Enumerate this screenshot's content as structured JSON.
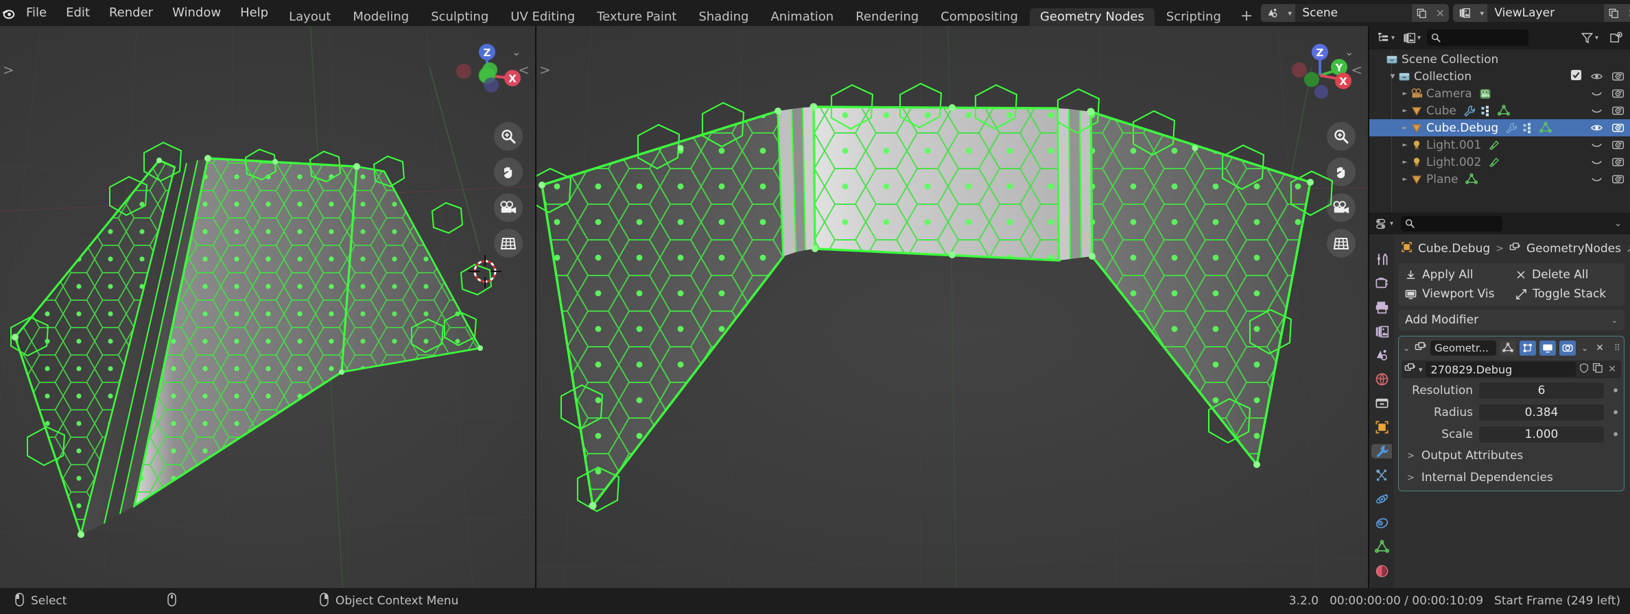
{
  "app": {
    "title": "Blender",
    "version": "3.2.0"
  },
  "topbar": {
    "logo_icon": "blender-logo-icon",
    "menus": [
      "File",
      "Edit",
      "Render",
      "Window",
      "Help"
    ],
    "workspaces": [
      {
        "label": "Layout",
        "active": false
      },
      {
        "label": "Modeling",
        "active": false
      },
      {
        "label": "Sculpting",
        "active": false
      },
      {
        "label": "UV Editing",
        "active": false
      },
      {
        "label": "Texture Paint",
        "active": false
      },
      {
        "label": "Shading",
        "active": false
      },
      {
        "label": "Animation",
        "active": false
      },
      {
        "label": "Rendering",
        "active": false
      },
      {
        "label": "Compositing",
        "active": false
      },
      {
        "label": "Geometry Nodes",
        "active": true
      },
      {
        "label": "Scripting",
        "active": false
      }
    ],
    "add_workspace_label": "+",
    "scene": {
      "icon": "scene-icon",
      "name": "Scene",
      "new_icon": "duplicate-icon",
      "unlink_icon": "close-icon"
    },
    "viewlayer": {
      "icon": "viewlayer-icon",
      "name": "ViewLayer",
      "new_icon": "duplicate-icon",
      "unlink_icon": "close-icon"
    }
  },
  "viewport_left": {
    "name": "3d-viewport-left",
    "gizmo_axes": [
      "Z",
      "X"
    ],
    "tools": [
      "zoom-icon",
      "hand-icon",
      "camera-icon",
      "grid-icon"
    ],
    "collapse_left_icon": ">",
    "collapse_right_icon": "<"
  },
  "viewport_right": {
    "name": "3d-viewport-right",
    "gizmo_axes": [
      "Z",
      "Y",
      "X"
    ],
    "tools": [
      "zoom-icon",
      "hand-icon",
      "camera-icon",
      "grid-icon"
    ],
    "collapse_left_icon": ">",
    "collapse_right_icon": "<"
  },
  "outliner": {
    "display_mode_icon": "outliner-display-mode-icon",
    "filter_type_icon": "viewlayer-icon",
    "search_placeholder": "",
    "search_value": "",
    "filter_icon": "funnel-icon",
    "new_collection_icon": "new-collection-icon",
    "rows": [
      {
        "name": "Scene Collection",
        "icon": "collection-icon",
        "indent": 0,
        "selected": false,
        "dimmed": false,
        "expandable": false,
        "expanded": false,
        "data_icons": [],
        "checkbox": false,
        "eye": "none",
        "camera": false
      },
      {
        "name": "Collection",
        "icon": "collection-icon",
        "indent": 1,
        "selected": false,
        "dimmed": false,
        "expandable": true,
        "expanded": true,
        "data_icons": [],
        "checkbox": true,
        "eye": "open",
        "camera": true
      },
      {
        "name": "Camera",
        "icon": "camera-object-icon",
        "indent": 2,
        "selected": false,
        "dimmed": true,
        "expandable": true,
        "expanded": false,
        "data_icons": [
          "camera-data-icon"
        ],
        "checkbox": false,
        "eye": "closed",
        "camera": true
      },
      {
        "name": "Cube",
        "icon": "mesh-object-icon",
        "indent": 2,
        "selected": false,
        "dimmed": true,
        "expandable": true,
        "expanded": false,
        "data_icons": [
          "wrench-icon",
          "nodes-icon",
          "mesh-data-icon"
        ],
        "checkbox": false,
        "eye": "closed",
        "camera": true
      },
      {
        "name": "Cube.Debug",
        "icon": "mesh-object-icon",
        "indent": 2,
        "selected": true,
        "dimmed": false,
        "expandable": true,
        "expanded": false,
        "data_icons": [
          "wrench-icon",
          "nodes-icon",
          "mesh-data-icon"
        ],
        "checkbox": false,
        "eye": "open",
        "camera": true
      },
      {
        "name": "Light.001",
        "icon": "light-object-icon",
        "indent": 2,
        "selected": false,
        "dimmed": true,
        "expandable": true,
        "expanded": false,
        "data_icons": [
          "light-data-icon"
        ],
        "checkbox": false,
        "eye": "closed",
        "camera": true
      },
      {
        "name": "Light.002",
        "icon": "light-object-icon",
        "indent": 2,
        "selected": false,
        "dimmed": true,
        "expandable": true,
        "expanded": false,
        "data_icons": [
          "light-data-icon"
        ],
        "checkbox": false,
        "eye": "closed",
        "camera": true
      },
      {
        "name": "Plane",
        "icon": "mesh-object-icon",
        "indent": 2,
        "selected": false,
        "dimmed": true,
        "expandable": true,
        "expanded": false,
        "data_icons": [
          "mesh-data-icon"
        ],
        "checkbox": false,
        "eye": "closed",
        "camera": true
      }
    ]
  },
  "properties": {
    "editor_type_icon": "properties-editor-icon",
    "search_placeholder": "",
    "search_value": "",
    "options_chev": "chevron-down-icon",
    "tabs": [
      {
        "name": "tool",
        "icon": "tool-icon",
        "active": false
      },
      {
        "name": "render",
        "icon": "render-icon",
        "active": false
      },
      {
        "name": "output",
        "icon": "printer-icon",
        "active": false
      },
      {
        "name": "view-layer",
        "icon": "images-icon",
        "active": false
      },
      {
        "name": "scene",
        "icon": "scene-icon",
        "active": false
      },
      {
        "name": "world",
        "icon": "world-icon",
        "active": false
      },
      {
        "name": "collection",
        "icon": "collection-icon",
        "active": false
      },
      {
        "name": "object",
        "icon": "object-icon",
        "active": false
      },
      {
        "name": "modifiers",
        "icon": "wrench-icon",
        "active": true
      },
      {
        "name": "particles",
        "icon": "particles-icon",
        "active": false
      },
      {
        "name": "physics",
        "icon": "physics-icon",
        "active": false
      },
      {
        "name": "constraints",
        "icon": "constraints-icon",
        "active": false
      },
      {
        "name": "data",
        "icon": "mesh-data-icon",
        "active": false
      },
      {
        "name": "material",
        "icon": "material-icon",
        "active": false
      },
      {
        "name": "texture",
        "icon": "texture-icon",
        "active": false
      }
    ],
    "breadcrumb": {
      "object_icon": "object-icon",
      "object": "Cube.Debug",
      "separator": ">",
      "modifier_icon": "geometry-nodes-icon",
      "modifier": "GeometryNodes",
      "pin_icon": "pin-icon"
    },
    "operations": [
      {
        "label": "Apply All",
        "icon": "download-icon"
      },
      {
        "label": "Delete All",
        "icon": "close-icon"
      },
      {
        "label": "Viewport Vis",
        "icon": "monitor-icon"
      },
      {
        "label": "Toggle Stack",
        "icon": "expand-icon"
      }
    ],
    "add_modifier": {
      "label": "Add Modifier",
      "chev": "chevron-down-icon"
    },
    "modifier": {
      "expand_icon": "chevron-down-icon",
      "type_icon": "geometry-nodes-icon",
      "name": "Geometr...",
      "toggles": [
        {
          "name": "on-cage",
          "icon": "mesh-data-icon",
          "on": false
        },
        {
          "name": "edit-mode",
          "icon": "edit-mode-icon",
          "on": true
        },
        {
          "name": "realtime",
          "icon": "monitor-icon",
          "on": true
        },
        {
          "name": "render",
          "icon": "camera-icon",
          "on": true
        }
      ],
      "extras_icon": "chevron-down-icon",
      "close_icon": "close-icon",
      "grip_icon": "grip-icon",
      "node_group": {
        "icon": "geometry-nodes-icon",
        "browse_icon": "chevron-down-icon",
        "name": "270829.Debug",
        "shield_icon": "fake-user-icon",
        "copy_icon": "duplicate-icon",
        "unlink_icon": "close-icon"
      },
      "inputs": [
        {
          "label": "Resolution",
          "value": "6",
          "animate_icon": "dot-icon"
        },
        {
          "label": "Radius",
          "value": "0.384",
          "animate_icon": "dot-icon"
        },
        {
          "label": "Scale",
          "value": "1.000",
          "animate_icon": "dot-icon"
        }
      ],
      "sub_panels": [
        {
          "label": "Output Attributes",
          "chev": ">"
        },
        {
          "label": "Internal Dependencies",
          "chev": ">"
        }
      ]
    }
  },
  "statusbar": {
    "items": [
      {
        "icon": "mouse-left-icon",
        "label": "Select"
      },
      {
        "icon": "mouse-middle-icon",
        "label": ""
      },
      {
        "icon": "mouse-right-icon",
        "label": "Object Context Menu"
      }
    ],
    "version": "3.2.0",
    "time": "00:00:00:00 / 00:00:10:09",
    "frame_info": "Start Frame (249 left)"
  },
  "colors": {
    "accent_blue": "#4772b3",
    "wire_green": "#4dd94d",
    "panel_bg": "#303030",
    "header_bg": "#1d1d1d",
    "outliner_bg": "#282828",
    "viewport_bg": "#3b3b3b",
    "axis_x": "#d9485e",
    "axis_y": "#5fbf3f",
    "axis_z": "#4e6fd4"
  }
}
